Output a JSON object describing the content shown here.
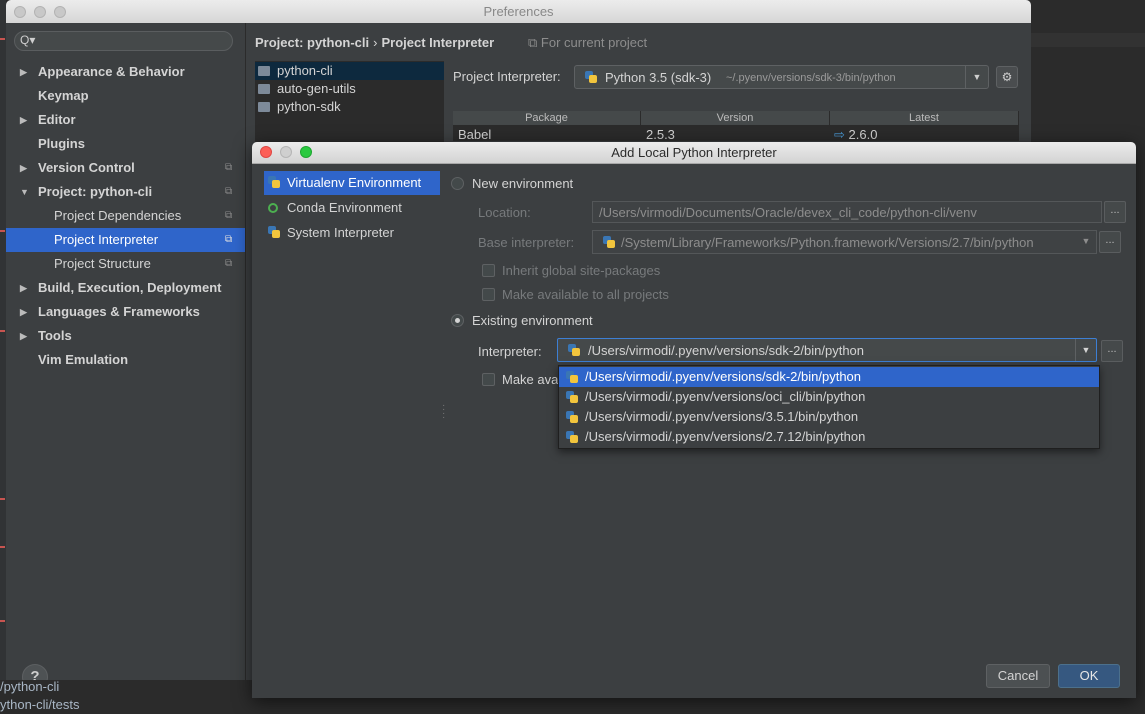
{
  "prefs_window": {
    "title": "Preferences",
    "search_placeholder": "",
    "search_icon": "Q▾",
    "sidebar": {
      "items": [
        {
          "label": "Appearance & Behavior",
          "expandable": true,
          "expanded": false
        },
        {
          "label": "Keymap",
          "expandable": false
        },
        {
          "label": "Editor",
          "expandable": true,
          "expanded": false
        },
        {
          "label": "Plugins",
          "expandable": false
        },
        {
          "label": "Version Control",
          "expandable": true,
          "expanded": false,
          "project_scoped": true
        },
        {
          "label": "Project: python-cli",
          "expandable": true,
          "expanded": true,
          "project_scoped": true
        },
        {
          "label": "Project Dependencies",
          "sub": true,
          "project_scoped": true
        },
        {
          "label": "Project Interpreter",
          "sub": true,
          "selected": true,
          "project_scoped": true
        },
        {
          "label": "Project Structure",
          "sub": true,
          "project_scoped": true
        },
        {
          "label": "Build, Execution, Deployment",
          "expandable": true,
          "expanded": false
        },
        {
          "label": "Languages & Frameworks",
          "expandable": true,
          "expanded": false
        },
        {
          "label": "Tools",
          "expandable": true,
          "expanded": false
        },
        {
          "label": "Vim Emulation",
          "expandable": false
        }
      ]
    },
    "help_label": "?",
    "breadcrumb": {
      "part1": "Project: python-cli",
      "separator": "›",
      "part2": "Project Interpreter"
    },
    "for_current_project": "For current project",
    "projects": [
      "python-cli",
      "auto-gen-utils",
      "python-sdk"
    ],
    "interpreter_label": "Project Interpreter:",
    "interpreter_name": "Python 3.5 (sdk-3)",
    "interpreter_path": "~/.pyenv/versions/sdk-3/bin/python",
    "packages": {
      "columns": [
        "Package",
        "Version",
        "Latest"
      ],
      "rows": [
        {
          "package": "Babel",
          "version": "2.5.3",
          "latest": "2.6.0",
          "upgrade_arrow": "⇨"
        }
      ]
    }
  },
  "dialog": {
    "title": "Add Local Python Interpreter",
    "env_types": [
      "Virtualenv Environment",
      "Conda Environment",
      "System Interpreter"
    ],
    "selected_env_type": "Virtualenv Environment",
    "new_env": {
      "label": "New environment",
      "location_label": "Location:",
      "location_value": "/Users/virmodi/Documents/Oracle/devex_cli_code/python-cli/venv",
      "base_label": "Base interpreter:",
      "base_value": "/System/Library/Frameworks/Python.framework/Versions/2.7/bin/python",
      "inherit_label": "Inherit global site-packages",
      "available_label": "Make available to all projects"
    },
    "existing_env": {
      "label": "Existing environment",
      "selected": true,
      "interpreter_label": "Interpreter:",
      "interpreter_value": "/Users/virmodi/.pyenv/versions/sdk-2/bin/python",
      "make_available_label_partial": "Make ava"
    },
    "dropdown_options": [
      "/Users/virmodi/.pyenv/versions/sdk-2/bin/python",
      "/Users/virmodi/.pyenv/versions/oci_cli/bin/python",
      "/Users/virmodi/.pyenv/versions/3.5.1/bin/python",
      "/Users/virmodi/.pyenv/versions/2.7.12/bin/python"
    ],
    "browse_label": "...",
    "cancel_label": "Cancel",
    "ok_label": "OK"
  },
  "background": {
    "bottom_lines": [
      "/python-cli",
      "ython-cli/tests"
    ]
  },
  "colors": {
    "accent": "#2f65ca",
    "window_bg": "#3c3f41",
    "editor_bg": "#2b2b2b"
  }
}
